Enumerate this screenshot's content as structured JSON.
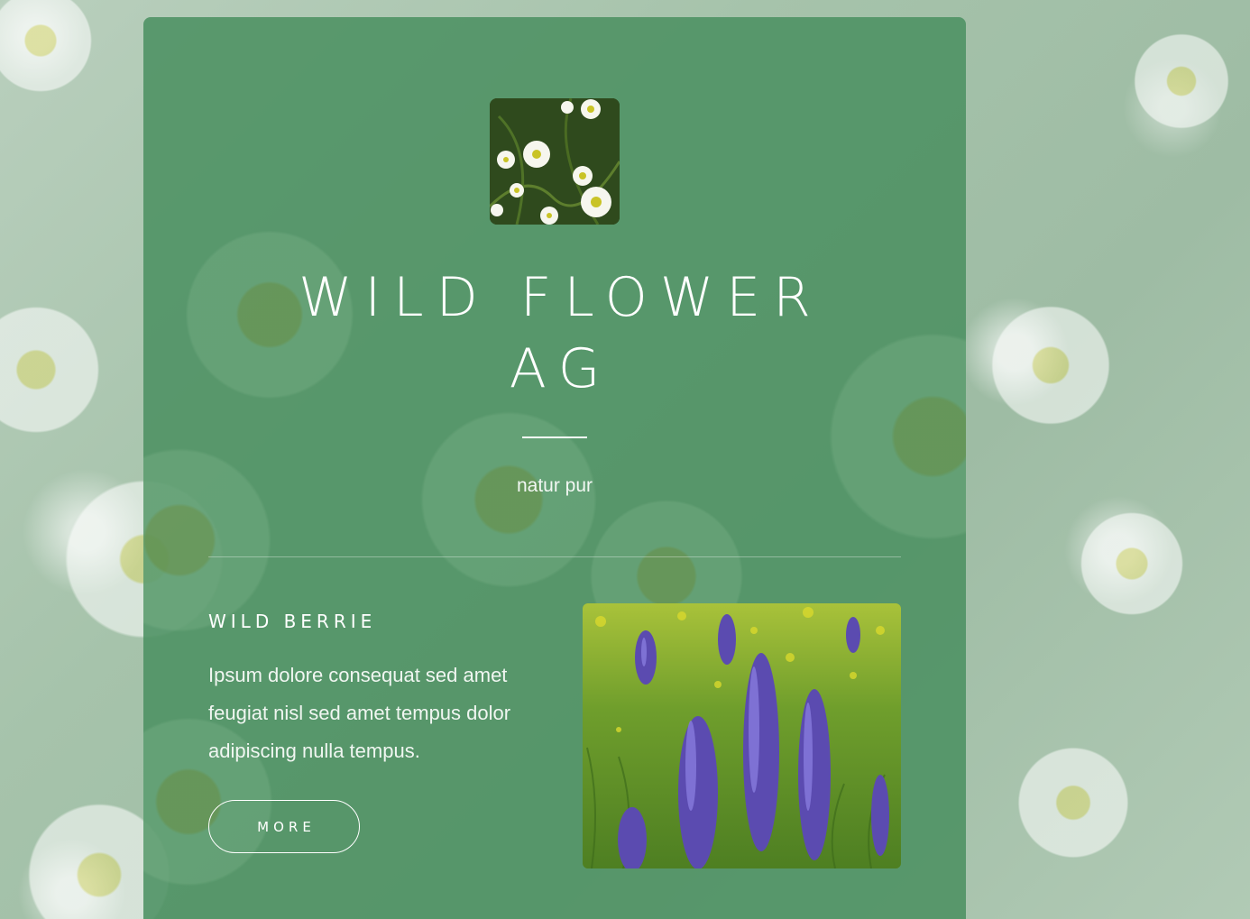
{
  "hero": {
    "logo_alt": "daisies",
    "title_line1": "WILD FLOWER",
    "title_line2": "AG",
    "tagline": "natur pur"
  },
  "feature": {
    "title": "WILD BERRIE",
    "text": "Ipsum dolore consequat sed amet feugiat nisl sed amet tempus dolor adipiscing nulla tempus.",
    "button_label": "MORE",
    "image_alt": "lupines"
  },
  "colors": {
    "card": "#4c9162",
    "background": "#a6c3ab",
    "text": "#ffffff",
    "lupine": "#5b4bb0"
  }
}
